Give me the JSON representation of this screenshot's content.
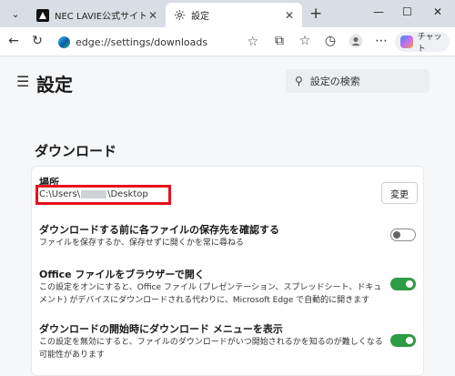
{
  "tabs": [
    {
      "title": "NEC LAVIE公式サイト > サ⋯",
      "favicon": "nec-page-icon"
    },
    {
      "title": "設定",
      "favicon": "gear-icon"
    }
  ],
  "address": {
    "url": "edge://settings/downloads"
  },
  "chat_label": "チャット",
  "page_title": "設定",
  "search": {
    "label": "設定の検索"
  },
  "section": {
    "title": "ダウンロード"
  },
  "location": {
    "title": "場所",
    "path_prefix": "C:\\Users\\",
    "path_suffix": "\\Desktop",
    "change_label": "変更"
  },
  "settings": [
    {
      "title": "ダウンロードする前に各ファイルの保存先を確認する",
      "description": "ファイルを保存するか、保存せずに開くかを常に尋ねる",
      "enabled": false
    },
    {
      "title": "Office ファイルをブラウザーで開く",
      "description": "この設定をオンにすると、Office ファイル (プレゼンテーション、スプレッドシート、ドキュメント) がデバイスにダウンロードされる代わりに、Microsoft Edge で自動的に開きます",
      "enabled": true
    },
    {
      "title": "ダウンロードの開始時にダウンロード メニューを表示",
      "description": "この設定を無効にすると、ファイルのダウンロードがいつ開始されるかを知るのが難しくなる可能性があります",
      "enabled": true
    }
  ],
  "colors": {
    "toggle_on": "#2e9b45",
    "highlight": "#e8101a"
  }
}
